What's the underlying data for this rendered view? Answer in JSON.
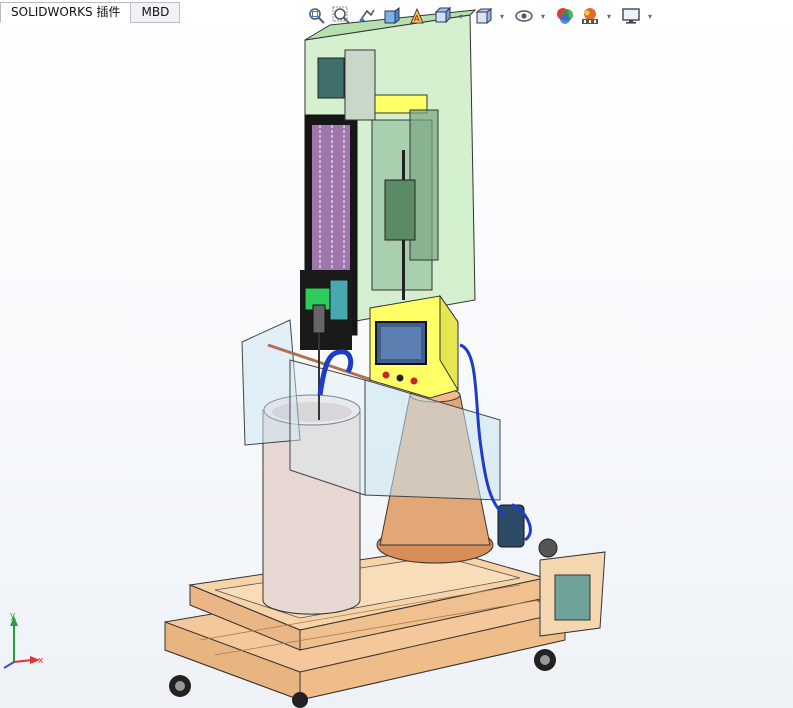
{
  "tabs": [
    {
      "label": "SOLIDWORKS 插件",
      "active": true
    },
    {
      "label": "MBD",
      "active": false
    }
  ],
  "heads_up_toolbar": [
    {
      "icon": "zoom-to-fit-icon",
      "dropdown": false
    },
    {
      "icon": "zoom-to-area-icon",
      "dropdown": false
    },
    {
      "icon": "previous-view-icon",
      "dropdown": false
    },
    {
      "icon": "section-view-icon",
      "dropdown": false
    },
    {
      "icon": "dynamic-annotation-view-icon",
      "dropdown": false
    },
    {
      "icon": "view-orientation-icon",
      "dropdown": true
    },
    {
      "icon": "display-style-icon",
      "dropdown": true
    },
    {
      "icon": "hide-show-items-icon",
      "dropdown": true
    },
    {
      "icon": "edit-appearance-icon",
      "dropdown": false
    },
    {
      "icon": "apply-scene-icon",
      "dropdown": true
    },
    {
      "icon": "view-settings-icon",
      "dropdown": true
    }
  ],
  "triad": {
    "x_label": "x",
    "y_label": "y"
  },
  "colors": {
    "frame_wood": "#f4c89a",
    "enclosure_glass": "#c9ecc2",
    "panel_yellow": "#ffff66",
    "cylinder": "#e8d8d4",
    "funnel": "#e3a677",
    "pipe_blue": "#1e3cc8"
  }
}
